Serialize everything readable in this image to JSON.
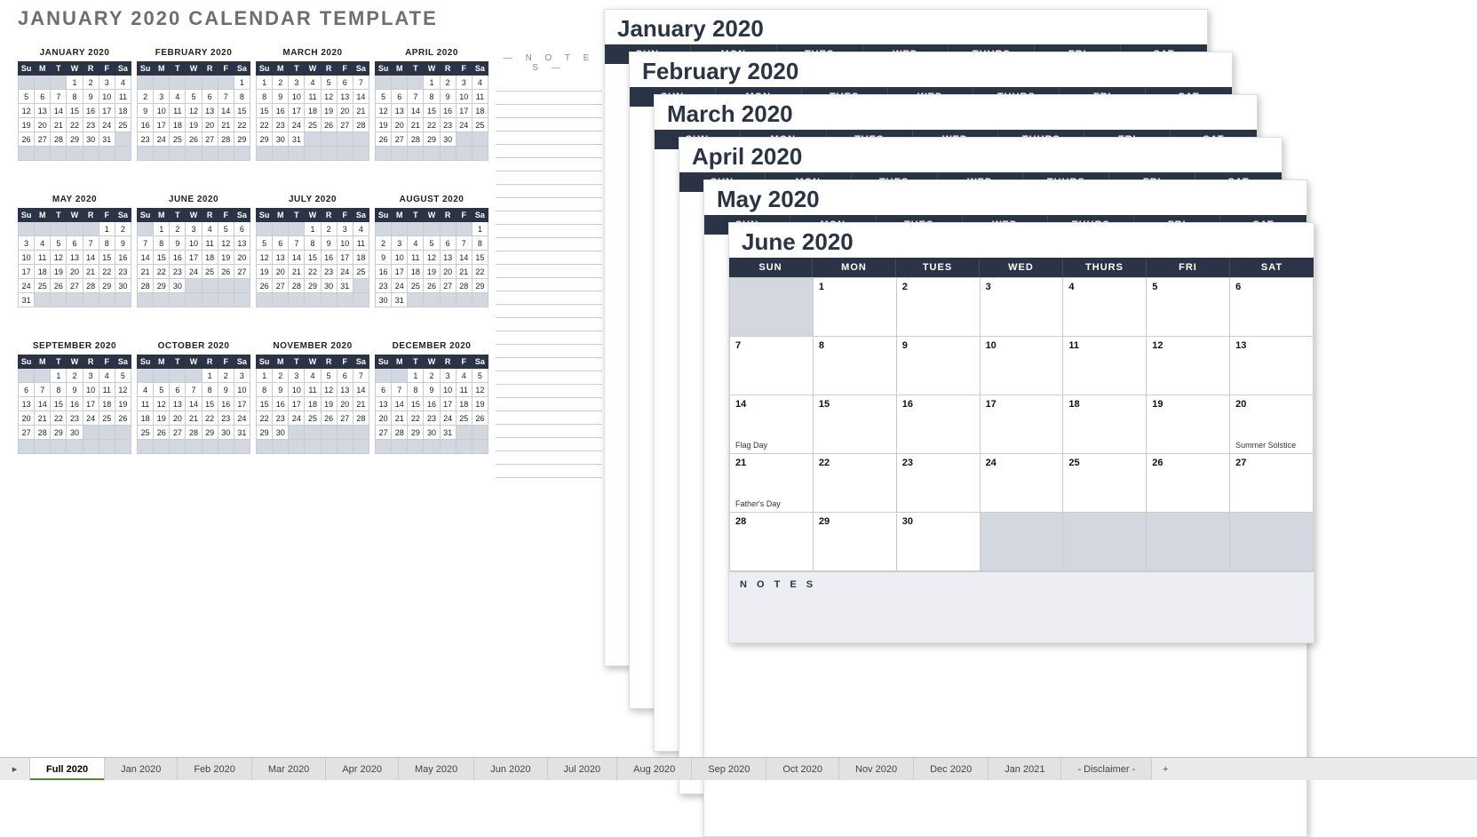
{
  "title": "JANUARY 2020 CALENDAR TEMPLATE",
  "notes_label": "— N  O  T  E  S —",
  "mini_dow": [
    "Su",
    "M",
    "T",
    "W",
    "R",
    "F",
    "Sa"
  ],
  "months": [
    {
      "name": "JANUARY 2020",
      "lead": 3,
      "days": 31
    },
    {
      "name": "FEBRUARY 2020",
      "lead": 6,
      "days": 29
    },
    {
      "name": "MARCH 2020",
      "lead": 0,
      "days": 31
    },
    {
      "name": "APRIL 2020",
      "lead": 3,
      "days": 30
    },
    {
      "name": "MAY 2020",
      "lead": 5,
      "days": 31
    },
    {
      "name": "JUNE 2020",
      "lead": 1,
      "days": 30
    },
    {
      "name": "JULY 2020",
      "lead": 3,
      "days": 31
    },
    {
      "name": "AUGUST 2020",
      "lead": 6,
      "days": 31
    },
    {
      "name": "SEPTEMBER 2020",
      "lead": 2,
      "days": 30
    },
    {
      "name": "OCTOBER 2020",
      "lead": 4,
      "days": 31
    },
    {
      "name": "NOVEMBER 2020",
      "lead": 0,
      "days": 30
    },
    {
      "name": "DECEMBER 2020",
      "lead": 2,
      "days": 31
    }
  ],
  "big_dow": [
    "SUN",
    "MON",
    "TUES",
    "WED",
    "THURS",
    "FRI",
    "SAT"
  ],
  "stack_titles": [
    "January 2020",
    "February 2020",
    "March 2020",
    "April 2020",
    "May 2020"
  ],
  "front": {
    "title": "June 2020",
    "lead": 1,
    "days": 30,
    "events": {
      "14": "Flag Day",
      "20": "Summer Solstice",
      "21": "Father's Day"
    },
    "notes_label": "N  O  T  E  S"
  },
  "tabs": [
    "Full 2020",
    "Jan 2020",
    "Feb 2020",
    "Mar 2020",
    "Apr 2020",
    "May 2020",
    "Jun 2020",
    "Jul 2020",
    "Aug 2020",
    "Sep 2020",
    "Oct 2020",
    "Nov 2020",
    "Dec 2020",
    "Jan 2021",
    "- Disclaimer -"
  ],
  "active_tab": 0
}
